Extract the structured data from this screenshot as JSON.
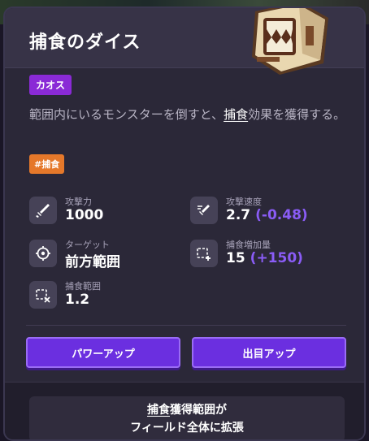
{
  "card": {
    "title": "捕食のダイス",
    "rarity_tag": "カオス",
    "description_prefix": "範囲内にいるモンスターを倒すと、",
    "description_keyword": "捕食",
    "description_suffix": "効果を獲得する。",
    "keyword_tag": "#捕食"
  },
  "stats": [
    {
      "icon": "sword-icon",
      "label": "攻撃力",
      "value": "1000",
      "delta": ""
    },
    {
      "icon": "attack-speed-icon",
      "label": "攻撃速度",
      "value": "2.7",
      "delta": "(-0.48)"
    },
    {
      "icon": "target-icon",
      "label": "ターゲット",
      "value": "前方範囲",
      "delta": ""
    },
    {
      "icon": "capture-increase-icon",
      "label": "捕食増加量",
      "value": "15",
      "delta": "(+150)"
    },
    {
      "icon": "capture-range-icon",
      "label": "捕食範囲",
      "value": "1.2",
      "delta": ""
    }
  ],
  "buttons": {
    "power_up": "パワーアップ",
    "pip_up": "出目アップ"
  },
  "info": {
    "keyword": "捕食",
    "line1_rest": "獲得範囲が",
    "line2": "フィールド全体に拡張"
  },
  "colors": {
    "accent_purple": "#6b2fe0",
    "chaos_tag": "#8a2ad6",
    "keyword_tag": "#e5782a",
    "delta_text": "#8a5cf6"
  }
}
